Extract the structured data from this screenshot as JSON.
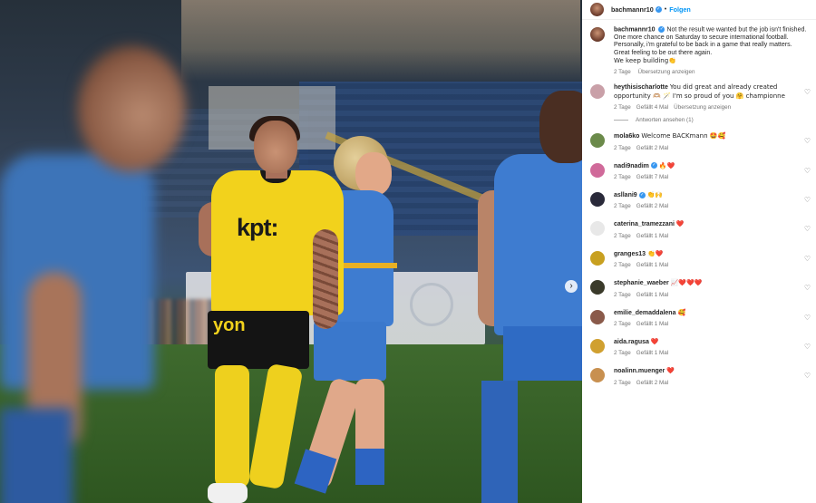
{
  "post": {
    "account": "bachmannr10",
    "follow_label": "Folgen",
    "separator": "•",
    "caption": {
      "user": "bachmannr10",
      "lines": [
        "Not the result we wanted but the job isn't finished. One more chance on Saturday to secure international football.",
        "Personally, i'm grateful to be back in a game that really matters.",
        "Great feeling to be out there again.",
        "We keep building👏"
      ],
      "time": "2 Tage",
      "translate": "Übersetzung anzeigen"
    },
    "photo": {
      "jersey_text": "kpt:",
      "shorts_text": "yon"
    }
  },
  "colors": {
    "accent": "#0095f6",
    "verified": "#3897f0",
    "meta_text": "#737373",
    "yellow_kit": "#f2d21c",
    "blue_kit": "#3e7cd0"
  },
  "comments": [
    {
      "user": "heythisischarlotte",
      "text": "You did great and already created opportunity 🫶🏼 🪄 I'm so proud of you 🤗 championne",
      "time": "2 Tage",
      "likes": "Gefällt 4 Mal",
      "translate": "Übersetzung anzeigen",
      "replies": "Antworten ansehen (1)",
      "avatar_color": "#c9a0a8"
    },
    {
      "user": "mola6ko",
      "text": "Welcome BACKmann 🤩🥰",
      "time": "2 Tage",
      "likes": "Gefällt 2 Mal",
      "avatar_color": "#6b8a4a"
    },
    {
      "user": "nadi9nadim",
      "verified": true,
      "text": "🔥❤️",
      "time": "2 Tage",
      "likes": "Gefällt 7 Mal",
      "avatar_color": "#d06a9a"
    },
    {
      "user": "asllani9",
      "verified": true,
      "text": "👏🙌",
      "time": "2 Tage",
      "likes": "Gefällt 2 Mal",
      "avatar_color": "#2a2a3a"
    },
    {
      "user": "caterina_tramezzani",
      "text": "❤️",
      "time": "2 Tage",
      "likes": "Gefällt 1 Mal",
      "avatar_color": "#e8e8e8"
    },
    {
      "user": "granges13",
      "text": "👏❤️",
      "time": "2 Tage",
      "likes": "Gefällt 1 Mal",
      "avatar_color": "#c8a020"
    },
    {
      "user": "stephanie_waeber",
      "text": "📈❤️❤️❤️",
      "time": "2 Tage",
      "likes": "Gefällt 1 Mal",
      "avatar_color": "#3a3a2a"
    },
    {
      "user": "emilie_demaddalena",
      "text": "🥰",
      "time": "2 Tage",
      "likes": "Gefällt 1 Mal",
      "avatar_color": "#8a5a4a"
    },
    {
      "user": "aida.ragusa",
      "text": "❤️",
      "time": "2 Tage",
      "likes": "Gefällt 1 Mal",
      "avatar_color": "#d0a030"
    },
    {
      "user": "noalinn.muenger",
      "text": "❤️",
      "time": "2 Tage",
      "likes": "Gefällt 2 Mal",
      "avatar_color": "#c89050"
    }
  ],
  "icons": {
    "heart": "heart-outline-icon",
    "verified": "verified-badge-icon",
    "carousel_next": "chevron-right-icon"
  }
}
